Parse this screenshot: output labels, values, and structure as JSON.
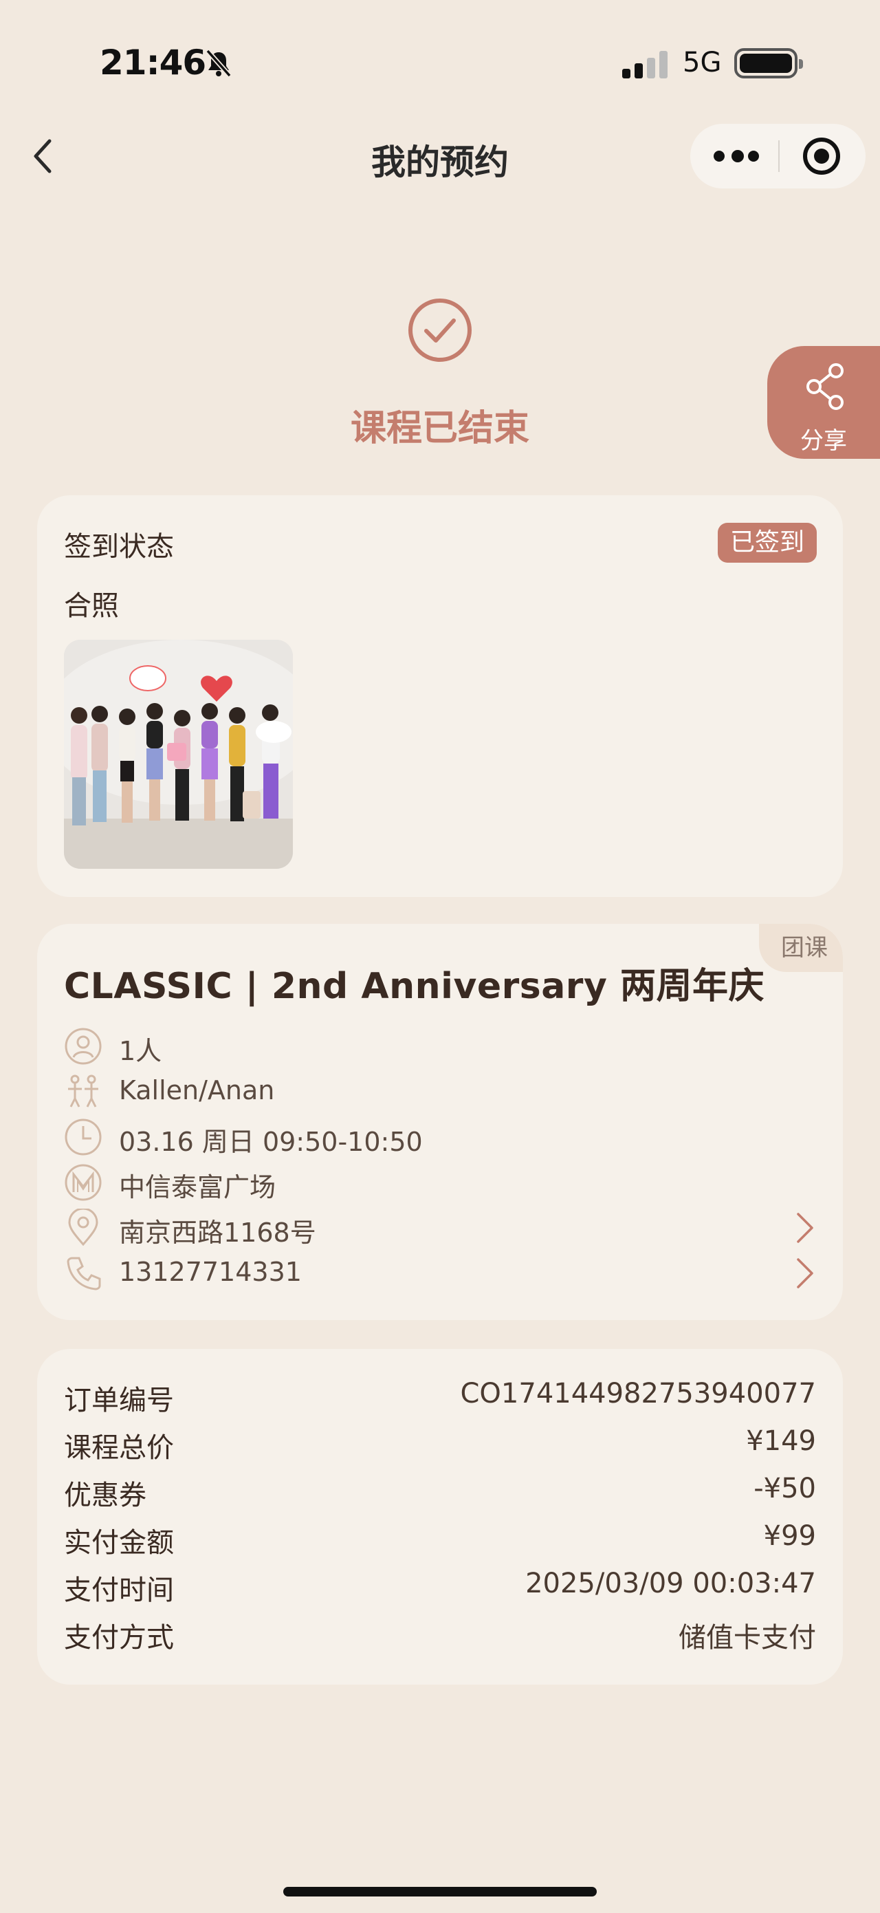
{
  "status_bar": {
    "time": "21:46",
    "network": "5G"
  },
  "nav": {
    "title": "我的预约"
  },
  "hero": {
    "status_text": "课程已结束"
  },
  "share": {
    "label": "分享"
  },
  "checkin": {
    "label": "签到状态",
    "badge": "已签到",
    "photo_label": "合照"
  },
  "course": {
    "tag": "团课",
    "title": "CLASSIC | 2nd Anniversary 两周年庆",
    "people": "1人",
    "instructors": "Kallen/Anan",
    "time": "03.16 周日 09:50-10:50",
    "venue": "中信泰富广场",
    "address": "南京西路1168号",
    "phone": "13127714331"
  },
  "order": {
    "rows": [
      {
        "key": "订单编号",
        "value": "CO174144982753940077"
      },
      {
        "key": "课程总价",
        "value": "¥149"
      },
      {
        "key": "优惠券",
        "value": "-¥50"
      },
      {
        "key": "实付金额",
        "value": "¥99"
      },
      {
        "key": "支付时间",
        "value": "2025/03/09 00:03:47"
      },
      {
        "key": "支付方式",
        "value": "储值卡支付"
      }
    ]
  },
  "colors": {
    "accent": "#c47d6d",
    "background": "#f2e9df",
    "card": "#f6f1ea"
  }
}
